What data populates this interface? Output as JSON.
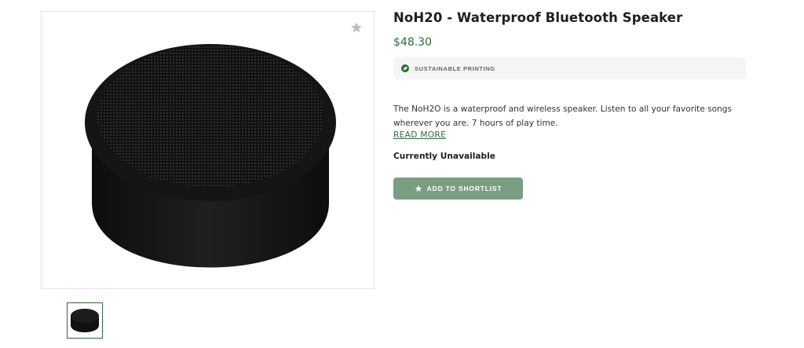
{
  "product": {
    "title": "NoH20 - Waterproof Bluetooth Speaker",
    "price": "$48.30",
    "badge": {
      "label": "SUSTAINABLE PRINTING",
      "icon": "leaf-icon"
    },
    "description": "The NoH2O is a waterproof and wireless speaker.  Listen to all your favorite songs wherever you are. 7 hours of play time.",
    "read_more": "READ MORE",
    "availability": "Currently Unavailable",
    "shortlist_button": "ADD TO SHORTLIST"
  },
  "colors": {
    "accent_green": "#2f6b3a",
    "button_bg": "#7a9e82",
    "badge_bg": "#f5f5f5"
  },
  "icons": {
    "favorite": "star-icon",
    "shortlist": "star-icon"
  }
}
